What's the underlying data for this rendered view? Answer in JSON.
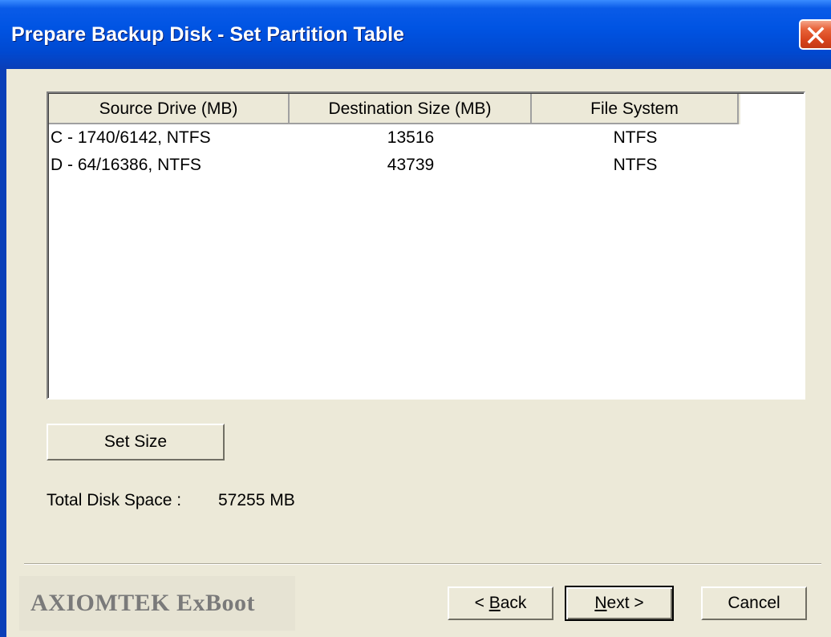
{
  "window": {
    "title": "Prepare Backup Disk - Set Partition Table"
  },
  "table": {
    "columns": [
      "Source Drive (MB)",
      "Destination Size (MB)",
      "File System"
    ],
    "rows": [
      {
        "source": "C - 1740/6142, NTFS",
        "destination": "13516",
        "filesystem": "NTFS"
      },
      {
        "source": "D - 64/16386, NTFS",
        "destination": "43739",
        "filesystem": "NTFS"
      }
    ]
  },
  "buttons": {
    "set_size": "Set Size",
    "back_prefix": "< ",
    "back_mnemonic": "B",
    "back_rest": "ack",
    "next_mnemonic": "N",
    "next_rest": "ext >",
    "cancel": "Cancel"
  },
  "total": {
    "label": "Total Disk Space :",
    "value": "57255 MB"
  },
  "brand": "AXIOMTEK ExBoot",
  "icons": {
    "close": "close-icon"
  }
}
